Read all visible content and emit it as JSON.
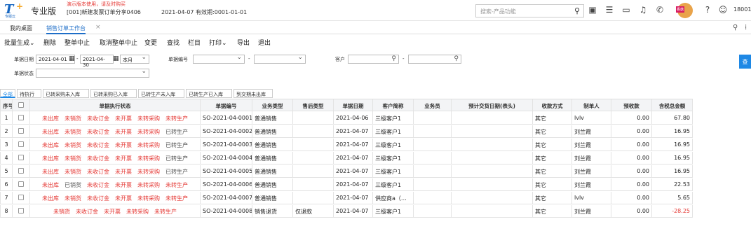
{
  "app": {
    "logo_text": "T",
    "logo_sub": "专版云",
    "product": "专业版",
    "warning": "演示版本使用，请及时购买",
    "account": "[001]新建发票订单分享0406",
    "account_date": "2021-04-07 有效期:0001-01-01",
    "search_placeholder": "搜索-产品功能",
    "user": "18001",
    "avatar_badge": "香菇"
  },
  "tabs": [
    {
      "label": "我的桌面"
    },
    {
      "label": "销售订单工作台"
    }
  ],
  "tab_close": "×",
  "toolbar": [
    "批量生成⌄",
    "删除",
    "整单中止",
    "取消整单中止",
    "变更",
    "查找",
    "栏目",
    "打印⌄",
    "导出",
    "退出"
  ],
  "filter": {
    "date_label": "单据日期",
    "date_from": "2021-04-01",
    "date_sep": "-",
    "date_to": "2021-04-30",
    "period": "本月",
    "code_label": "单据编号",
    "code_sep": "-",
    "customer_label": "客户",
    "customer_sep": "-",
    "status_label": "单据状态",
    "query_btn": "查"
  },
  "status_tabs": [
    "全部",
    "待执行",
    "已转采购未入库",
    "已转采购已入库",
    "已转生产未入库",
    "已转生产已入库",
    "到交期未出库"
  ],
  "columns": [
    "序号",
    "",
    "单据执行状态",
    "单据编号",
    "业务类型",
    "售后类型",
    "单据日期",
    "客户简称",
    "业务员",
    "预计交货日期(表头)",
    "收款方式",
    "制单人",
    "预收款",
    "含税总金额"
  ],
  "rows": [
    {
      "no": "1",
      "status": [
        {
          "t": "未出库",
          "ok": false
        },
        {
          "t": "未销货",
          "ok": false
        },
        {
          "t": "未收订金",
          "ok": false
        },
        {
          "t": "未开票",
          "ok": false
        },
        {
          "t": "未转采购",
          "ok": false
        },
        {
          "t": "未转生产",
          "ok": false
        }
      ],
      "code": "SO-2021-04-0001",
      "biz": "普通销售",
      "after": "",
      "date": "2021-04-06",
      "customer": "三级客户1",
      "clerk": "",
      "delivery": "",
      "pay": "其它",
      "maker": "lvlv",
      "prepay": "0.00",
      "total": "67.80",
      "neg": false
    },
    {
      "no": "2",
      "status": [
        {
          "t": "未出库",
          "ok": false
        },
        {
          "t": "未销货",
          "ok": false
        },
        {
          "t": "未收订金",
          "ok": false
        },
        {
          "t": "未开票",
          "ok": false
        },
        {
          "t": "未转采购",
          "ok": false
        },
        {
          "t": "已转生产",
          "ok": true
        }
      ],
      "code": "SO-2021-04-0002",
      "biz": "普通销售",
      "after": "",
      "date": "2021-04-07",
      "customer": "三级客户1",
      "clerk": "",
      "delivery": "",
      "pay": "其它",
      "maker": "刘兰霞",
      "prepay": "0.00",
      "total": "16.95",
      "neg": false
    },
    {
      "no": "3",
      "status": [
        {
          "t": "未出库",
          "ok": false
        },
        {
          "t": "未销货",
          "ok": false
        },
        {
          "t": "未收订金",
          "ok": false
        },
        {
          "t": "未开票",
          "ok": false
        },
        {
          "t": "未转采购",
          "ok": false
        },
        {
          "t": "已转生产",
          "ok": true
        }
      ],
      "code": "SO-2021-04-0003",
      "biz": "普通销售",
      "after": "",
      "date": "2021-04-07",
      "customer": "三级客户1",
      "clerk": "",
      "delivery": "",
      "pay": "其它",
      "maker": "刘兰霞",
      "prepay": "0.00",
      "total": "16.95",
      "neg": false
    },
    {
      "no": "4",
      "status": [
        {
          "t": "未出库",
          "ok": false
        },
        {
          "t": "未销货",
          "ok": false
        },
        {
          "t": "未收订金",
          "ok": false
        },
        {
          "t": "未开票",
          "ok": false
        },
        {
          "t": "未转采购",
          "ok": false
        },
        {
          "t": "已转生产",
          "ok": true
        }
      ],
      "code": "SO-2021-04-0004",
      "biz": "普通销售",
      "after": "",
      "date": "2021-04-07",
      "customer": "三级客户1",
      "clerk": "",
      "delivery": "",
      "pay": "其它",
      "maker": "刘兰霞",
      "prepay": "0.00",
      "total": "16.95",
      "neg": false
    },
    {
      "no": "5",
      "status": [
        {
          "t": "未出库",
          "ok": false
        },
        {
          "t": "未销货",
          "ok": false
        },
        {
          "t": "未收订金",
          "ok": false
        },
        {
          "t": "未开票",
          "ok": false
        },
        {
          "t": "未转采购",
          "ok": false
        },
        {
          "t": "已转生产",
          "ok": true
        }
      ],
      "code": "SO-2021-04-0005",
      "biz": "普通销售",
      "after": "",
      "date": "2021-04-07",
      "customer": "三级客户1",
      "clerk": "",
      "delivery": "",
      "pay": "其它",
      "maker": "刘兰霞",
      "prepay": "0.00",
      "total": "16.95",
      "neg": false
    },
    {
      "no": "6",
      "status": [
        {
          "t": "未出库",
          "ok": false
        },
        {
          "t": "已销货",
          "ok": true
        },
        {
          "t": "未收订金",
          "ok": false
        },
        {
          "t": "未开票",
          "ok": false
        },
        {
          "t": "未转采购",
          "ok": false
        },
        {
          "t": "未转生产",
          "ok": false
        }
      ],
      "code": "SO-2021-04-0006",
      "biz": "普通销售",
      "after": "",
      "date": "2021-04-07",
      "customer": "三级客户1",
      "clerk": "",
      "delivery": "",
      "pay": "其它",
      "maker": "刘兰霞",
      "prepay": "0.00",
      "total": "22.53",
      "neg": false
    },
    {
      "no": "7",
      "status": [
        {
          "t": "未出库",
          "ok": false
        },
        {
          "t": "未销货",
          "ok": false
        },
        {
          "t": "未收订金",
          "ok": false
        },
        {
          "t": "未开票",
          "ok": false
        },
        {
          "t": "未转采购",
          "ok": false
        },
        {
          "t": "未转生产",
          "ok": false
        }
      ],
      "code": "SO-2021-04-0007",
      "biz": "普通销售",
      "after": "",
      "date": "2021-04-07",
      "customer": "供应商a（…",
      "clerk": "",
      "delivery": "",
      "pay": "其它",
      "maker": "lvlv",
      "prepay": "0.00",
      "total": "5.65",
      "neg": false
    },
    {
      "no": "8",
      "status": [
        {
          "t": "未销货",
          "ok": false
        },
        {
          "t": "未收订金",
          "ok": false
        },
        {
          "t": "未开票",
          "ok": false
        },
        {
          "t": "未转采购",
          "ok": false
        },
        {
          "t": "未转生产",
          "ok": false
        }
      ],
      "code": "SO-2021-04-0008",
      "biz": "销售退货",
      "after": "仅退款",
      "date": "2021-04-07",
      "customer": "三级客户1",
      "clerk": "",
      "delivery": "",
      "pay": "其它",
      "maker": "刘兰霞",
      "prepay": "0.00",
      "total": "-28.25",
      "neg": true
    }
  ]
}
